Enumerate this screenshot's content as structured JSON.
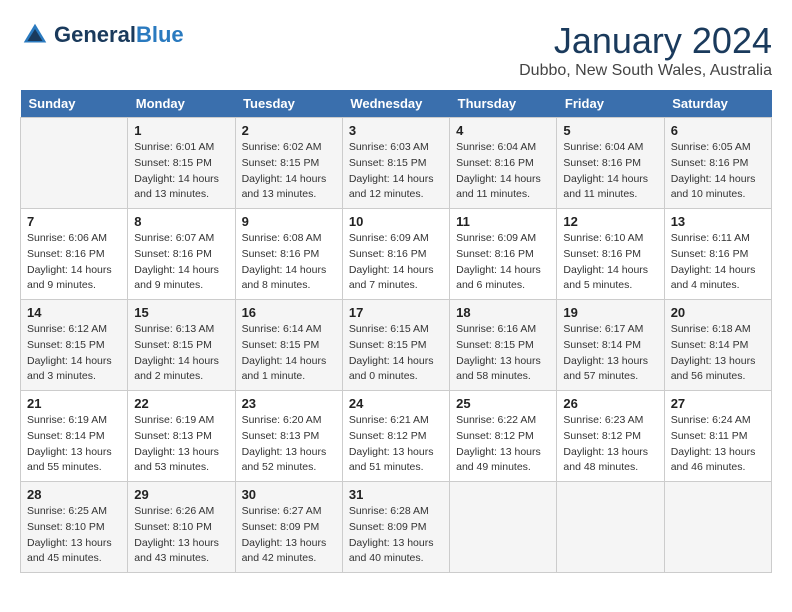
{
  "header": {
    "logo_line1": "General",
    "logo_line2": "Blue",
    "month_title": "January 2024",
    "subtitle": "Dubbo, New South Wales, Australia"
  },
  "days_of_week": [
    "Sunday",
    "Monday",
    "Tuesday",
    "Wednesday",
    "Thursday",
    "Friday",
    "Saturday"
  ],
  "weeks": [
    [
      {
        "day": "",
        "info": ""
      },
      {
        "day": "1",
        "info": "Sunrise: 6:01 AM\nSunset: 8:15 PM\nDaylight: 14 hours\nand 13 minutes."
      },
      {
        "day": "2",
        "info": "Sunrise: 6:02 AM\nSunset: 8:15 PM\nDaylight: 14 hours\nand 13 minutes."
      },
      {
        "day": "3",
        "info": "Sunrise: 6:03 AM\nSunset: 8:15 PM\nDaylight: 14 hours\nand 12 minutes."
      },
      {
        "day": "4",
        "info": "Sunrise: 6:04 AM\nSunset: 8:16 PM\nDaylight: 14 hours\nand 11 minutes."
      },
      {
        "day": "5",
        "info": "Sunrise: 6:04 AM\nSunset: 8:16 PM\nDaylight: 14 hours\nand 11 minutes."
      },
      {
        "day": "6",
        "info": "Sunrise: 6:05 AM\nSunset: 8:16 PM\nDaylight: 14 hours\nand 10 minutes."
      }
    ],
    [
      {
        "day": "7",
        "info": "Sunrise: 6:06 AM\nSunset: 8:16 PM\nDaylight: 14 hours\nand 9 minutes."
      },
      {
        "day": "8",
        "info": "Sunrise: 6:07 AM\nSunset: 8:16 PM\nDaylight: 14 hours\nand 9 minutes."
      },
      {
        "day": "9",
        "info": "Sunrise: 6:08 AM\nSunset: 8:16 PM\nDaylight: 14 hours\nand 8 minutes."
      },
      {
        "day": "10",
        "info": "Sunrise: 6:09 AM\nSunset: 8:16 PM\nDaylight: 14 hours\nand 7 minutes."
      },
      {
        "day": "11",
        "info": "Sunrise: 6:09 AM\nSunset: 8:16 PM\nDaylight: 14 hours\nand 6 minutes."
      },
      {
        "day": "12",
        "info": "Sunrise: 6:10 AM\nSunset: 8:16 PM\nDaylight: 14 hours\nand 5 minutes."
      },
      {
        "day": "13",
        "info": "Sunrise: 6:11 AM\nSunset: 8:16 PM\nDaylight: 14 hours\nand 4 minutes."
      }
    ],
    [
      {
        "day": "14",
        "info": "Sunrise: 6:12 AM\nSunset: 8:15 PM\nDaylight: 14 hours\nand 3 minutes."
      },
      {
        "day": "15",
        "info": "Sunrise: 6:13 AM\nSunset: 8:15 PM\nDaylight: 14 hours\nand 2 minutes."
      },
      {
        "day": "16",
        "info": "Sunrise: 6:14 AM\nSunset: 8:15 PM\nDaylight: 14 hours\nand 1 minute."
      },
      {
        "day": "17",
        "info": "Sunrise: 6:15 AM\nSunset: 8:15 PM\nDaylight: 14 hours\nand 0 minutes."
      },
      {
        "day": "18",
        "info": "Sunrise: 6:16 AM\nSunset: 8:15 PM\nDaylight: 13 hours\nand 58 minutes."
      },
      {
        "day": "19",
        "info": "Sunrise: 6:17 AM\nSunset: 8:14 PM\nDaylight: 13 hours\nand 57 minutes."
      },
      {
        "day": "20",
        "info": "Sunrise: 6:18 AM\nSunset: 8:14 PM\nDaylight: 13 hours\nand 56 minutes."
      }
    ],
    [
      {
        "day": "21",
        "info": "Sunrise: 6:19 AM\nSunset: 8:14 PM\nDaylight: 13 hours\nand 55 minutes."
      },
      {
        "day": "22",
        "info": "Sunrise: 6:19 AM\nSunset: 8:13 PM\nDaylight: 13 hours\nand 53 minutes."
      },
      {
        "day": "23",
        "info": "Sunrise: 6:20 AM\nSunset: 8:13 PM\nDaylight: 13 hours\nand 52 minutes."
      },
      {
        "day": "24",
        "info": "Sunrise: 6:21 AM\nSunset: 8:12 PM\nDaylight: 13 hours\nand 51 minutes."
      },
      {
        "day": "25",
        "info": "Sunrise: 6:22 AM\nSunset: 8:12 PM\nDaylight: 13 hours\nand 49 minutes."
      },
      {
        "day": "26",
        "info": "Sunrise: 6:23 AM\nSunset: 8:12 PM\nDaylight: 13 hours\nand 48 minutes."
      },
      {
        "day": "27",
        "info": "Sunrise: 6:24 AM\nSunset: 8:11 PM\nDaylight: 13 hours\nand 46 minutes."
      }
    ],
    [
      {
        "day": "28",
        "info": "Sunrise: 6:25 AM\nSunset: 8:10 PM\nDaylight: 13 hours\nand 45 minutes."
      },
      {
        "day": "29",
        "info": "Sunrise: 6:26 AM\nSunset: 8:10 PM\nDaylight: 13 hours\nand 43 minutes."
      },
      {
        "day": "30",
        "info": "Sunrise: 6:27 AM\nSunset: 8:09 PM\nDaylight: 13 hours\nand 42 minutes."
      },
      {
        "day": "31",
        "info": "Sunrise: 6:28 AM\nSunset: 8:09 PM\nDaylight: 13 hours\nand 40 minutes."
      },
      {
        "day": "",
        "info": ""
      },
      {
        "day": "",
        "info": ""
      },
      {
        "day": "",
        "info": ""
      }
    ]
  ]
}
